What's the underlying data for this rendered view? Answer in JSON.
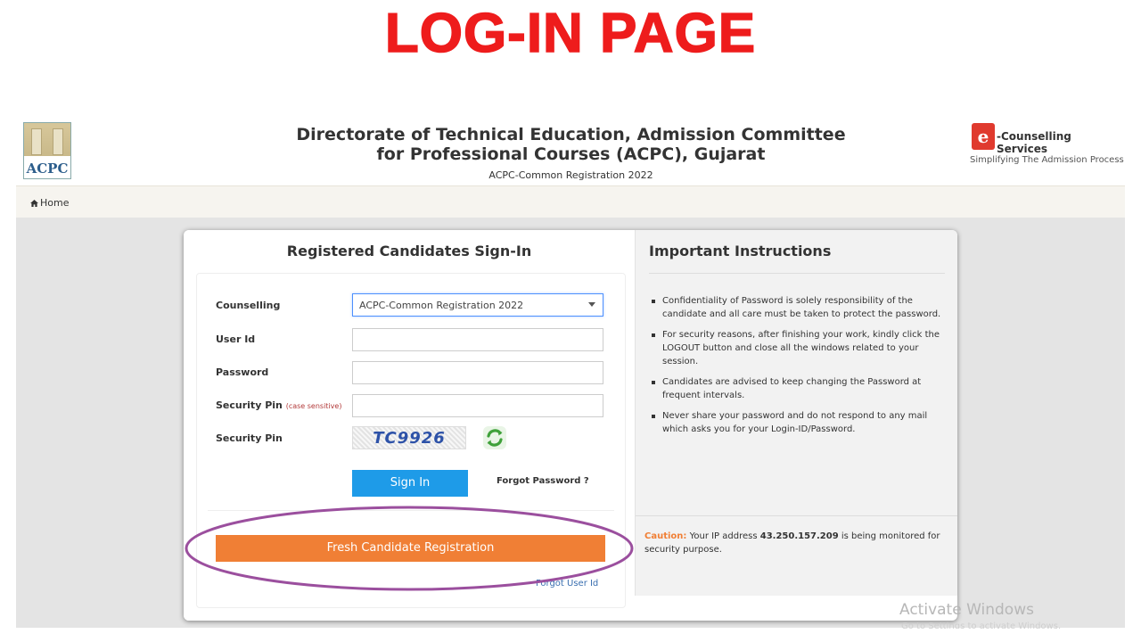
{
  "banner": {
    "title": "LOG-IN PAGE"
  },
  "header": {
    "acpc_logo_text": "ACPC",
    "title": "Directorate of Technical Education, Admission Committee for Professional Courses (ACPC), Gujarat",
    "subtitle": "ACPC-Common Registration 2022",
    "ecs_logo_letter": "e",
    "ecs_name": "-Counselling Services",
    "ecs_tagline": "Simplifying The Admission Process"
  },
  "nav": {
    "home_label": "Home"
  },
  "signin": {
    "title": "Registered Candidates Sign-In",
    "labels": {
      "counselling": "Counselling",
      "user_id": "User Id",
      "password": "Password",
      "security_pin_input": "Security Pin",
      "case_sensitive": "(case sensitive)",
      "security_pin_captcha": "Security Pin"
    },
    "counselling_value": "ACPC-Common Registration 2022",
    "user_id_value": "",
    "password_value": "",
    "security_pin_value": "",
    "captcha_text": "TC9926",
    "sign_in_button": "Sign In",
    "forgot_password": "Forgot Password ?",
    "fresh_registration": "Fresh Candidate Registration",
    "forgot_user_id": "Forgot User Id"
  },
  "instructions": {
    "title": "Important Instructions",
    "items": [
      "Confidentiality of Password is solely responsibility of the candidate and all care must be taken to protect the password.",
      "For security reasons, after finishing your work, kindly click the LOGOUT button and close all the windows related to your session.",
      "Candidates are advised to keep changing the Password at frequent intervals.",
      "Never share your password and do not respond to any mail which asks you for your Login-ID/Password."
    ],
    "caution_label": "Caution:",
    "caution_pre": " Your IP address ",
    "ip_address": "43.250.157.209",
    "caution_post": " is being monitored for security purpose."
  },
  "watermark": {
    "line1": "Activate Windows",
    "line2": "Go to Settings to activate Windows."
  },
  "colors": {
    "banner_red": "#ee1c1c",
    "sign_in_blue": "#1e9be8",
    "fresh_orange": "#f07f35",
    "highlight_purple": "#9b4f9e"
  }
}
